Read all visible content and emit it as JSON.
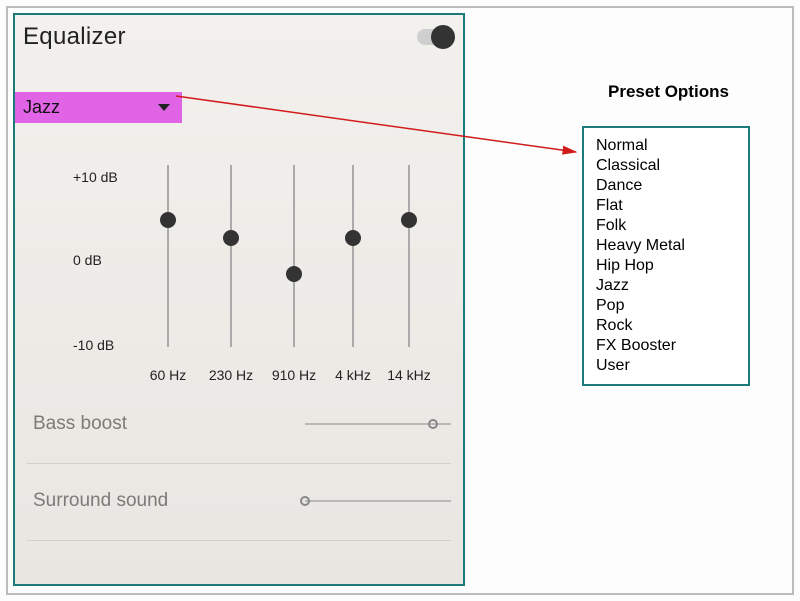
{
  "header": {
    "title": "Equalizer",
    "toggle_on": true
  },
  "preset": {
    "selected": "Jazz",
    "options": [
      "Normal",
      "Classical",
      "Dance",
      "Flat",
      "Folk",
      "Heavy Metal",
      "Hip Hop",
      "Jazz",
      "Pop",
      "Rock",
      "FX Booster",
      "User"
    ]
  },
  "db_scale": {
    "top": "+10 dB",
    "mid": "0 dB",
    "bot": "-10 dB"
  },
  "bands": [
    {
      "label": "60 Hz",
      "value_db": 4
    },
    {
      "label": "230 Hz",
      "value_db": 2
    },
    {
      "label": "910 Hz",
      "value_db": -2
    },
    {
      "label": "4 kHz",
      "value_db": 2
    },
    {
      "label": "14 kHz",
      "value_db": 4
    }
  ],
  "bass_boost": {
    "label": "Bass boost",
    "value_pct": 88
  },
  "surround_sound": {
    "label": "Surround sound",
    "value_pct": 0
  },
  "annotation_title": "Preset Options",
  "colors": {
    "teal": "#1b7b7b",
    "magenta": "#e164e7",
    "arrow": "#d11b1b"
  }
}
